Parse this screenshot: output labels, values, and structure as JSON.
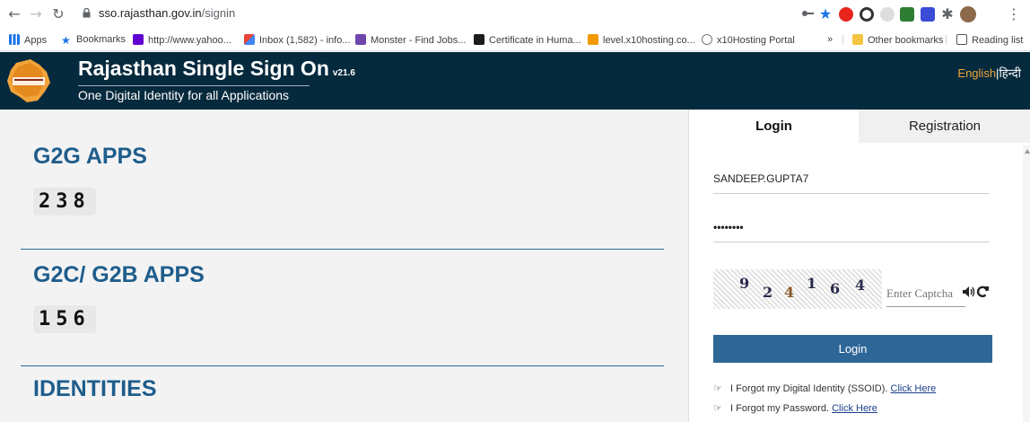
{
  "browser": {
    "url_host": "sso.rajasthan.gov.in",
    "url_path": "/signin",
    "bookmarks": [
      {
        "label": "Apps",
        "color": "#1a73e8"
      },
      {
        "label": "Bookmarks",
        "color": "#1a73e8"
      },
      {
        "label": "http://www.yahoo...",
        "color": "#6001d2"
      },
      {
        "label": "Inbox (1,582) - info...",
        "color": "#d93025"
      },
      {
        "label": "Monster - Find Jobs...",
        "color": "#6e46ae"
      },
      {
        "label": "Certificate in Huma...",
        "color": "#1b1b1b"
      },
      {
        "label": "level.x10hosting.co...",
        "color": "#f29900"
      },
      {
        "label": "x10Hosting Portal",
        "color": "#3c4043"
      }
    ],
    "other_bookmarks": "Other bookmarks",
    "reading_list": "Reading list",
    "overflow": "»"
  },
  "header": {
    "title": "Rajasthan Single Sign On",
    "version": "v21.6",
    "subtitle": "One Digital Identity for all Applications",
    "lang_en": "English",
    "lang_sep": "|",
    "lang_hi": "हिन्दी"
  },
  "stats": {
    "g2g_title": "G2G APPS",
    "g2g_count": "238",
    "g2c_title": "G2C/ G2B APPS",
    "g2c_count": "156",
    "identities_title": "IDENTITIES"
  },
  "login": {
    "tab_login": "Login",
    "tab_registration": "Registration",
    "username_value": "SANDEEP.GUPTA7",
    "password_value": "••••••••",
    "captcha_digits": [
      "9",
      "2",
      "4",
      "1",
      "6",
      "4"
    ],
    "captcha_placeholder": "Enter Captcha",
    "login_button": "Login",
    "forgot_ssoid": "I Forgot my Digital Identity (SSOID).",
    "forgot_password": "I Forgot my Password.",
    "click_here": "Click Here"
  },
  "colors": {
    "header_bg": "#062a3d",
    "accent_blue": "#1e5d8c",
    "button_blue": "#2e6797",
    "lang_orange": "#f2a33a"
  }
}
